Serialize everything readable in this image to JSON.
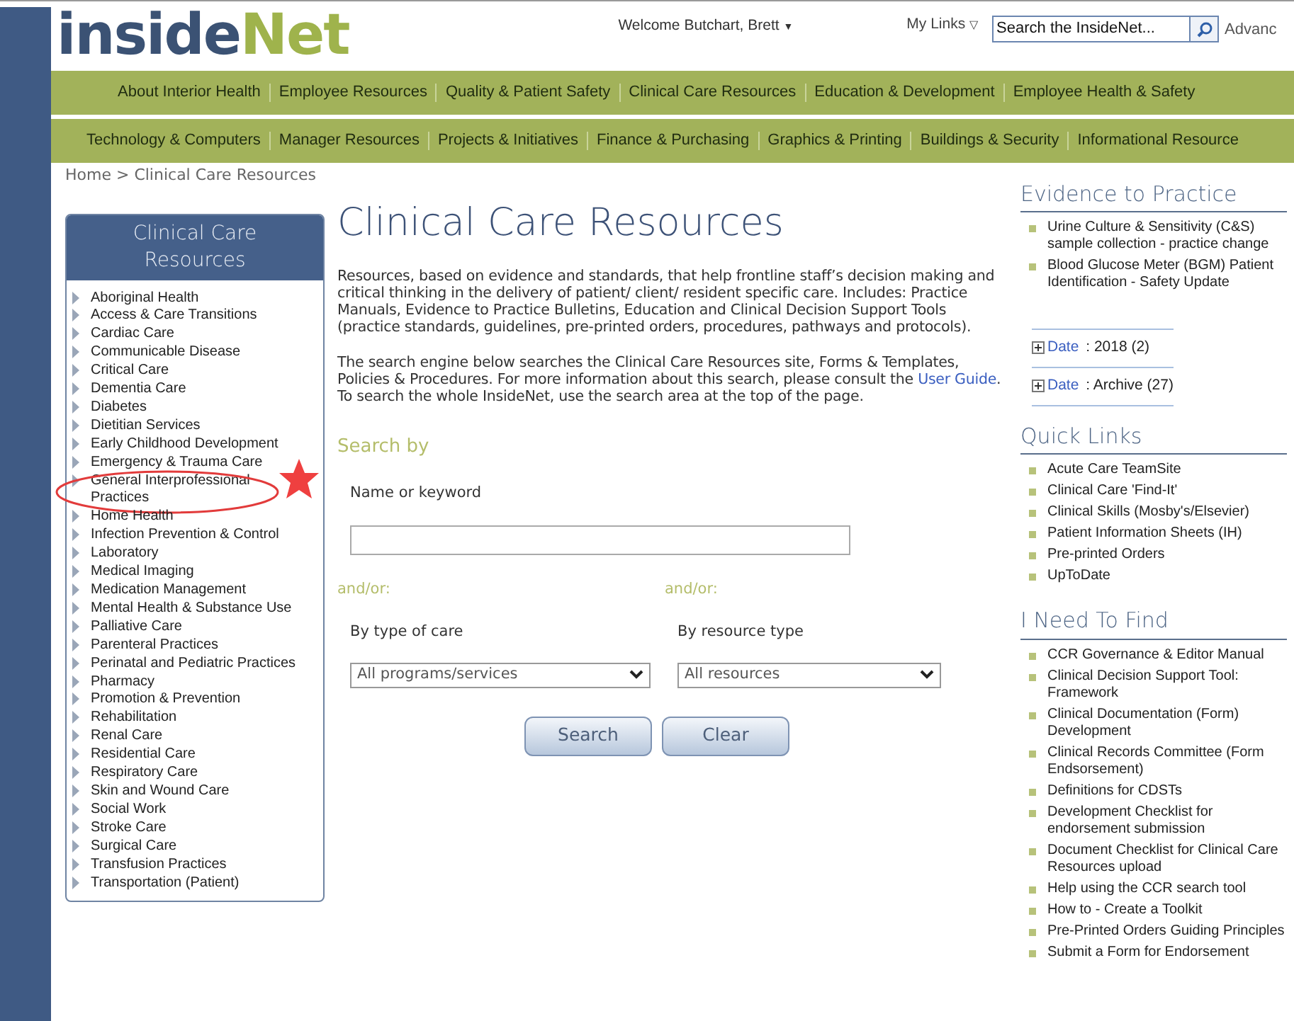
{
  "header": {
    "logo": {
      "part_1": "inside",
      "part_2": "Net"
    },
    "welcome": "Welcome Butchart, Brett",
    "welcome_arrow": "▼",
    "my_links": "My Links",
    "my_links_arrow": "▽",
    "search": {
      "placeholder": "Search the InsideNet..."
    },
    "advanced": "Advanc"
  },
  "nav_row_1": [
    "About Interior Health",
    "Employee Resources",
    "Quality & Patient Safety",
    "Clinical Care Resources",
    "Education & Development",
    "Employee Health & Safety"
  ],
  "nav_row_2": [
    "Technology & Computers",
    "Manager Resources",
    "Projects & Initiatives",
    "Finance & Purchasing",
    "Graphics & Printing",
    "Buildings & Security",
    "Informational Resource"
  ],
  "breadcrumb": "Home > Clinical Care Resources",
  "sidebar": {
    "title": "Clinical Care Resources",
    "items": [
      {
        "label": "Aboriginal Health",
        "highlighted": false
      },
      {
        "label": "Access & Care Transitions",
        "highlighted": false
      },
      {
        "label": "Cardiac Care",
        "highlighted": false
      },
      {
        "label": "Communicable Disease",
        "highlighted": false
      },
      {
        "label": "Critical Care",
        "highlighted": false
      },
      {
        "label": "Dementia Care",
        "highlighted": false
      },
      {
        "label": "Diabetes",
        "highlighted": false
      },
      {
        "label": "Dietitian Services",
        "highlighted": false
      },
      {
        "label": "Early Childhood Development",
        "highlighted": false
      },
      {
        "label": "Emergency & Trauma Care",
        "highlighted": false
      },
      {
        "label_lines": [
          "General Interprofessional",
          "Practices"
        ],
        "highlighted": true
      },
      {
        "label": "Home Health",
        "highlighted": false
      },
      {
        "label": "Infection Prevention & Control",
        "highlighted": false
      },
      {
        "label": "Laboratory",
        "highlighted": false
      },
      {
        "label": "Medical Imaging",
        "highlighted": false
      },
      {
        "label": "Medication Management",
        "highlighted": false
      },
      {
        "label": "Mental Health & Substance Use",
        "highlighted": false
      },
      {
        "label": "Palliative Care",
        "highlighted": false
      },
      {
        "label": "Parenteral Practices",
        "highlighted": false
      },
      {
        "label": "Perinatal and Pediatric Practices",
        "highlighted": false
      },
      {
        "label": "Pharmacy",
        "highlighted": false
      },
      {
        "label": "Promotion & Prevention",
        "highlighted": false
      },
      {
        "label": "Rehabilitation",
        "highlighted": false
      },
      {
        "label": "Renal Care",
        "highlighted": false
      },
      {
        "label": "Residential Care",
        "highlighted": false
      },
      {
        "label": "Respiratory Care",
        "highlighted": false
      },
      {
        "label": "Skin and Wound Care",
        "highlighted": false
      },
      {
        "label": "Social Work",
        "highlighted": false
      },
      {
        "label": "Stroke Care",
        "highlighted": false
      },
      {
        "label": "Surgical Care",
        "highlighted": false
      },
      {
        "label": "Transfusion Practices",
        "highlighted": false
      },
      {
        "label": "Transportation (Patient)",
        "highlighted": false
      }
    ]
  },
  "main": {
    "title": "Clinical Care Resources",
    "intro": "Resources, based on evidence and standards, that help frontline staff’s decision making and critical thinking in the delivery of patient/ client/ resident specific care.  Includes: Practice Manuals, Evidence to Practice Bulletins, Education and Clinical Decision Support Tools (practice standards, guidelines, pre-printed orders, procedures, pathways and protocols).",
    "search_note_before": "The search engine below searches the Clinical Care Resources site, Forms & Templates, Policies & Procedures.  For more information about this search, please consult the",
    "search_note_link": "User Guide",
    "search_note_after": ".  To search the whole InsideNet, use the search area at the top of the page.",
    "search_by": "Search by",
    "keyword_label": "Name or keyword",
    "andor_1": "and/or:",
    "andor_2": "and/or:",
    "type_label": "By type of care",
    "type_value": "All programs/services",
    "resource_label": "By resource type",
    "resource_value": "All resources",
    "buttons": [
      "Search",
      "Clear"
    ]
  },
  "evidence": {
    "title": "Evidence to Practice",
    "items": [
      "Urine Culture & Sensitivity (C&S) sample collection - practice change",
      "Blood Glucose Meter (BGM) Patient Identification - Safety Update"
    ],
    "groups": [
      {
        "link": "Date",
        "value": " : 2018 (2)"
      },
      {
        "link": "Date",
        "value": " : Archive (27)"
      }
    ]
  },
  "quick_links": {
    "title": "Quick Links",
    "items": [
      "Acute Care TeamSite",
      "Clinical Care 'Find-It'",
      "Clinical Skills (Mosby's/Elsevier)",
      "Patient Information Sheets (IH)",
      "Pre-printed Orders",
      "UpToDate"
    ]
  },
  "need_to_find": {
    "title": "I Need To Find",
    "items": [
      "CCR Governance & Editor Manual",
      "Clinical Decision Support Tool: Framework",
      "Clinical Documentation (Form) Development",
      "Clinical Records Committee (Form Endsorsement)",
      "Definitions for CDSTs",
      "Development Checklist for endorsement submission",
      "Document Checklist for Clinical Care Resources upload",
      "Help using the CCR search tool",
      "How to - Create a Toolkit",
      "Pre-Printed Orders Guiding Principles",
      "Submit a Form for Endorsement"
    ]
  }
}
